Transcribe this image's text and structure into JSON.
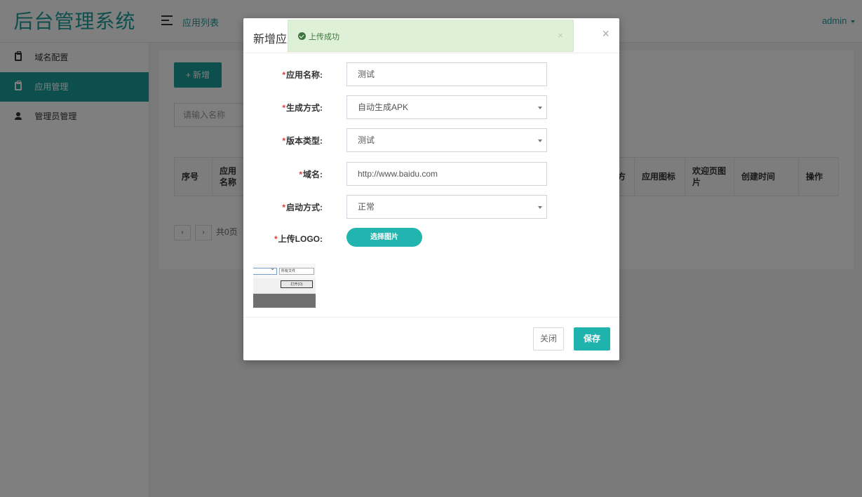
{
  "app": {
    "logo": "后台管理系统",
    "breadcrumb": "应用列表",
    "user": "admin"
  },
  "sidebar": {
    "items": [
      {
        "label": "域名配置",
        "icon": "clipboard-icon",
        "active": false
      },
      {
        "label": "应用管理",
        "icon": "clipboard-icon",
        "active": true
      },
      {
        "label": "管理员管理",
        "icon": "user-icon",
        "active": false
      }
    ]
  },
  "main": {
    "add_button": "+ 新增",
    "search_placeholder": "请输入名称",
    "table_headers": [
      "序号",
      "应用名称",
      "方",
      "应用图标",
      "欢迎页图片",
      "创建时间",
      "操作"
    ],
    "pager": {
      "prev": "‹",
      "next": "›",
      "total": "共0页"
    }
  },
  "modal": {
    "title": "新增应用",
    "close_symbol": "×",
    "toast": {
      "message": "上传成功",
      "close_symbol": "×"
    },
    "fields": [
      {
        "label": "应用名称:",
        "value": "测试",
        "type": "input"
      },
      {
        "label": "生成方式:",
        "value": "自动生成APK",
        "type": "select"
      },
      {
        "label": "版本类型:",
        "value": "测试",
        "type": "select"
      },
      {
        "label": "域名:",
        "value": "http://www.baidu.com",
        "type": "input"
      },
      {
        "label": "启动方式:",
        "value": "正常",
        "type": "select"
      }
    ],
    "upload_label": "上传LOGO:",
    "upload_button": "选择图片",
    "thumbnail": {
      "file_type_text": "所有文件",
      "open_text": "打开(O)"
    },
    "footer": {
      "close": "关闭",
      "save": "保存"
    }
  },
  "colors": {
    "primary": "#1a9e9a",
    "button": "#1fb3ae",
    "required": "#e53935",
    "toast_bg": "#dff0d8",
    "toast_text": "#3c763d"
  }
}
